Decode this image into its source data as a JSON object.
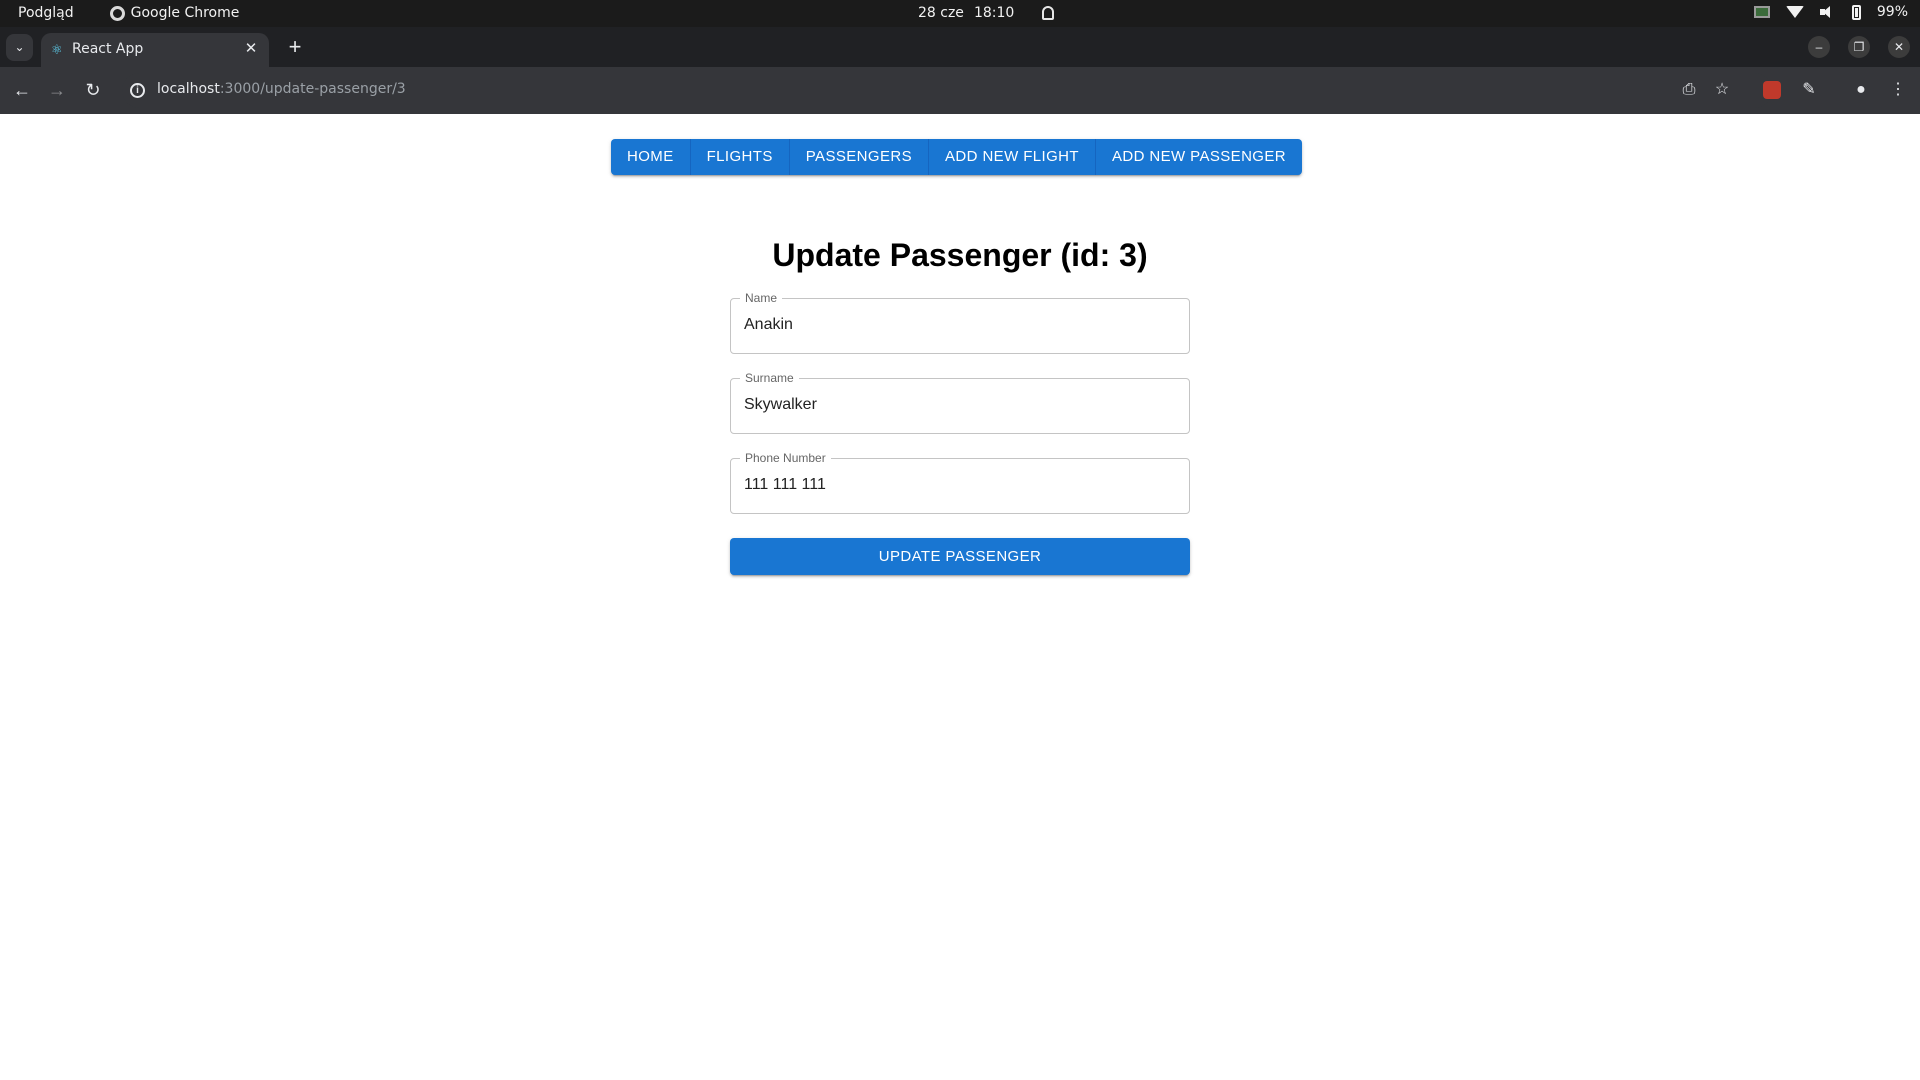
{
  "os_bar": {
    "activities": "Podgląd",
    "app_name": "Google Chrome",
    "date": "28 cze",
    "time": "18:10",
    "battery": "99%"
  },
  "browser": {
    "tab_title": "React App",
    "url_host": "localhost",
    "url_path": ":3000/update-passenger/3",
    "icons": [
      "back-icon",
      "forward-icon",
      "reload-icon",
      "site-info-icon",
      "install-icon",
      "bookmark-star-icon",
      "extension-icon",
      "puzzle-icon",
      "profile-icon",
      "menu-icon"
    ]
  },
  "nav": {
    "items": [
      "HOME",
      "FLIGHTS",
      "PASSENGERS",
      "ADD NEW FLIGHT",
      "ADD NEW PASSENGER"
    ],
    "color": "#1976d2"
  },
  "form": {
    "title": "Update Passenger (id: 3)",
    "fields": [
      {
        "label": "Name",
        "value": "Anakin"
      },
      {
        "label": "Surname",
        "value": "Skywalker"
      },
      {
        "label": "Phone Number",
        "value": "111 111 111"
      }
    ],
    "submit_label": "UPDATE PASSENGER"
  }
}
